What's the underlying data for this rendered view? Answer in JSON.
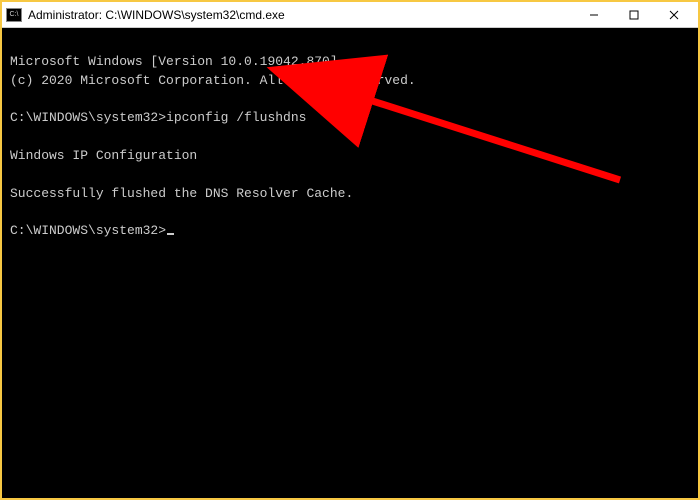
{
  "titlebar": {
    "icon_label": "C:\\",
    "title": "Administrator: C:\\WINDOWS\\system32\\cmd.exe"
  },
  "console": {
    "line1": "Microsoft Windows [Version 10.0.19042.870]",
    "line2": "(c) 2020 Microsoft Corporation. All rights reserved.",
    "blank1": " ",
    "prompt1": "C:\\WINDOWS\\system32>",
    "command1": "ipconfig /flushdns",
    "blank2": " ",
    "heading": "Windows IP Configuration",
    "blank3": " ",
    "result": "Successfully flushed the DNS Resolver Cache.",
    "blank4": " ",
    "prompt2": "C:\\WINDOWS\\system32>"
  },
  "annotation": {
    "color": "#ff0000"
  }
}
